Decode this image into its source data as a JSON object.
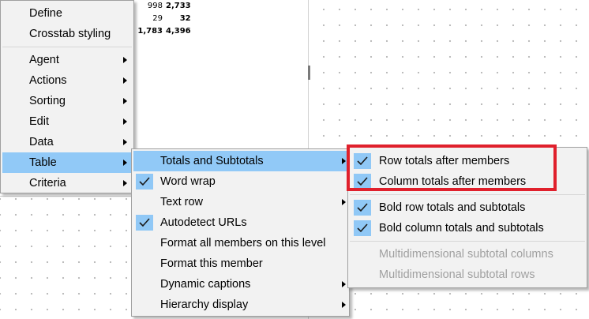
{
  "grid": {
    "rows": [
      {
        "v1": "998",
        "v2": "2,733"
      },
      {
        "v1": "29",
        "v2": "32"
      },
      {
        "v1": "1,783",
        "v2": "4,396"
      }
    ]
  },
  "context_menu": {
    "items": [
      {
        "label": "Define"
      },
      {
        "label": "Crosstab styling"
      },
      {
        "label": "Agent"
      },
      {
        "label": "Actions"
      },
      {
        "label": "Sorting"
      },
      {
        "label": "Edit"
      },
      {
        "label": "Data"
      },
      {
        "label": "Table"
      },
      {
        "label": "Criteria"
      }
    ]
  },
  "table_submenu": {
    "items": [
      {
        "label": "Totals and Subtotals"
      },
      {
        "label": "Word wrap",
        "checked": true
      },
      {
        "label": "Text row"
      },
      {
        "label": "Autodetect URLs",
        "checked": true
      },
      {
        "label": "Format all members on this level"
      },
      {
        "label": "Format this member"
      },
      {
        "label": "Dynamic captions"
      },
      {
        "label": "Hierarchy display"
      }
    ]
  },
  "totals_submenu": {
    "items": [
      {
        "label": "Row totals after members",
        "checked": true
      },
      {
        "label": "Column totals after members",
        "checked": true
      },
      {
        "label": "Bold row totals and subtotals",
        "checked": true
      },
      {
        "label": "Bold column totals and subtotals",
        "checked": true
      },
      {
        "label": "Multidimensional subtotal columns",
        "disabled": true
      },
      {
        "label": "Multidimensional subtotal rows",
        "disabled": true
      }
    ]
  },
  "colors": {
    "highlight": "#91c9f7",
    "annotation": "#e0202c"
  }
}
